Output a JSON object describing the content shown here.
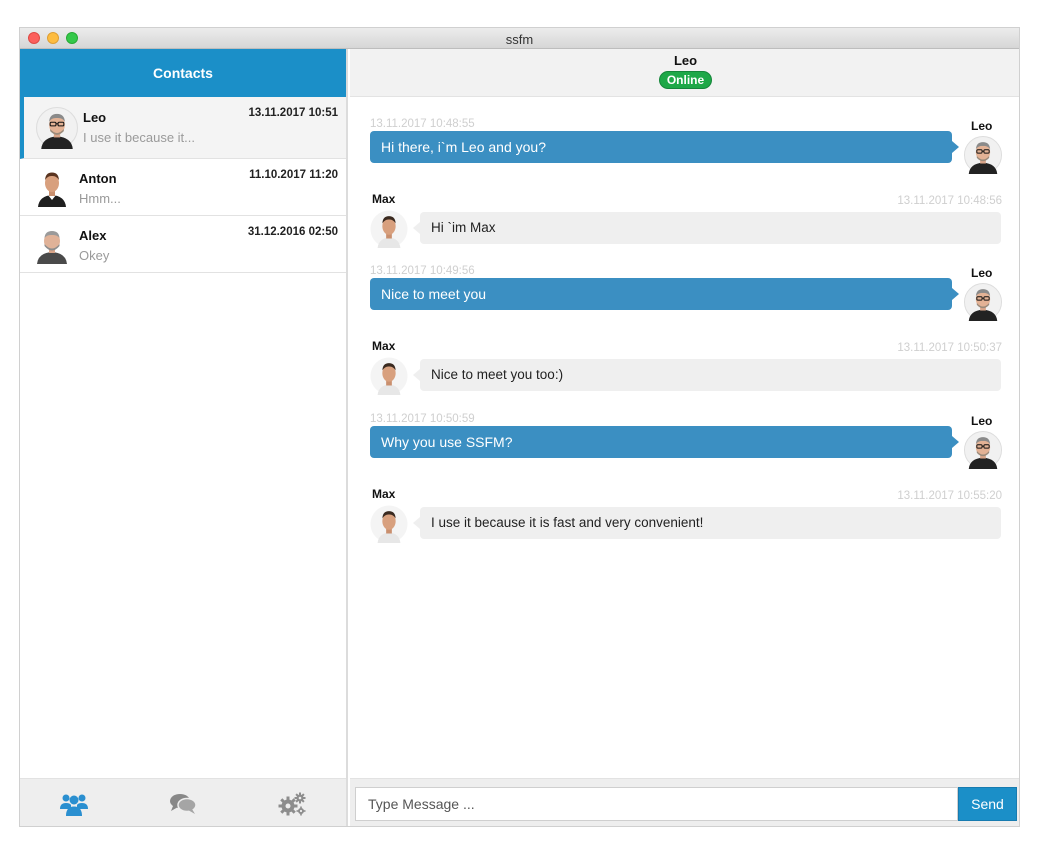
{
  "window": {
    "title": "ssfm"
  },
  "sidebar": {
    "header": "Contacts",
    "contacts": [
      {
        "name": "Leo",
        "preview": "I use it because it...",
        "date": "13.11.2017 10:51"
      },
      {
        "name": "Anton",
        "preview": "Hmm...",
        "date": "11.10.2017 11:20"
      },
      {
        "name": "Alex",
        "preview": "Okey",
        "date": "31.12.2016 02:50"
      }
    ],
    "footer_icons": [
      "users-icon",
      "chat-bubbles-icon",
      "gears-icon"
    ]
  },
  "chat": {
    "contact_name": "Leo",
    "status": "Online",
    "messages": [
      {
        "sender": "Leo",
        "time": "13.11.2017 10:48:55",
        "text": "Hi there, i`m Leo and you?",
        "direction": "out"
      },
      {
        "sender": "Max",
        "time": "13.11.2017 10:48:56",
        "text": "Hi `im Max",
        "direction": "in"
      },
      {
        "sender": "Leo",
        "time": "13.11.2017 10:49:56",
        "text": "Nice to meet you",
        "direction": "out"
      },
      {
        "sender": "Max",
        "time": "13.11.2017 10:50:37",
        "text": "Nice to meet you too:)",
        "direction": "in"
      },
      {
        "sender": "Leo",
        "time": "13.11.2017 10:50:59",
        "text": "Why you use SSFM?",
        "direction": "out"
      },
      {
        "sender": "Max",
        "time": "13.11.2017 10:55:20",
        "text": "I use it because it is fast and very convenient!",
        "direction": "in"
      }
    ]
  },
  "composer": {
    "placeholder": "Type Message ...",
    "send_label": "Send"
  },
  "colors": {
    "accent": "#1b8fc8",
    "outgoing_bubble": "#3b8fc2",
    "incoming_bubble": "#efefef",
    "online": "#1ea848"
  }
}
